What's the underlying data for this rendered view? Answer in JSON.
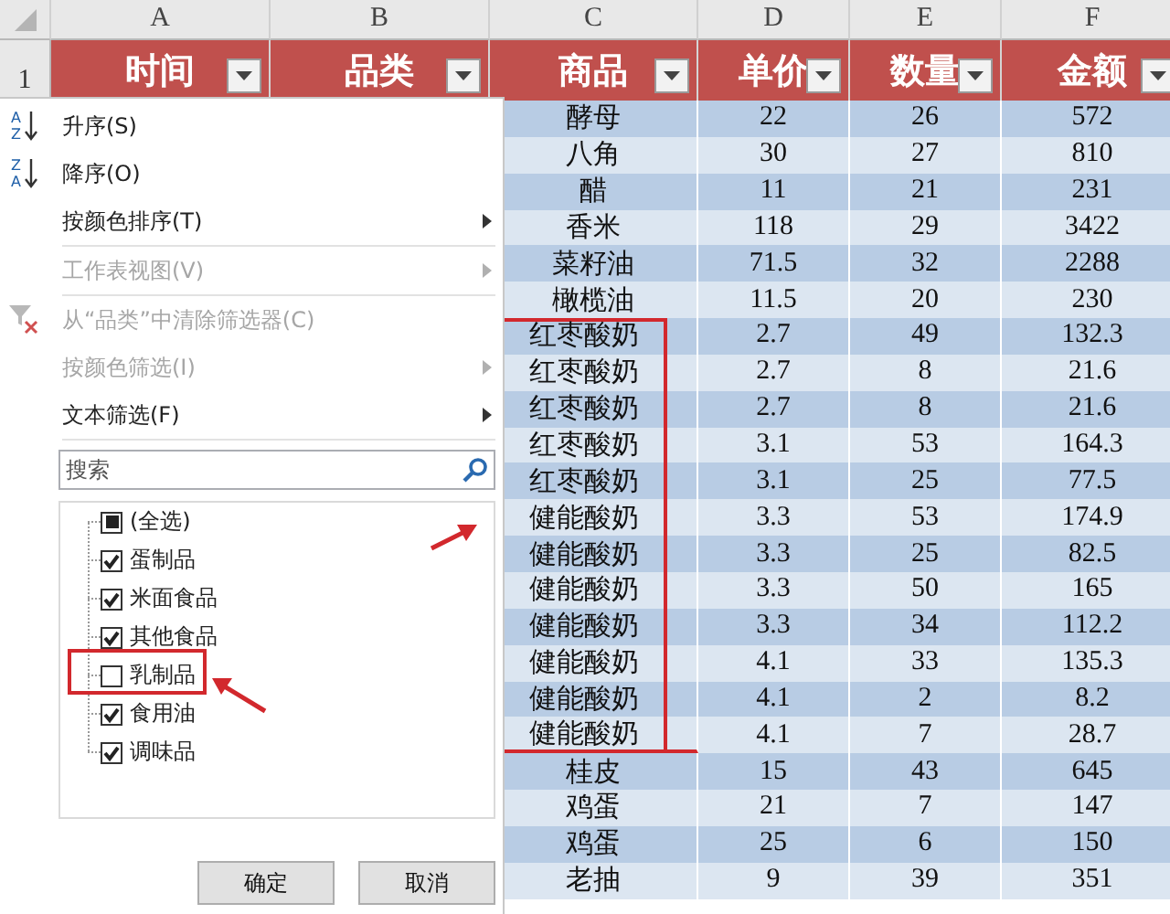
{
  "columns": [
    {
      "letter": "A",
      "header": "时间"
    },
    {
      "letter": "B",
      "header": "品类"
    },
    {
      "letter": "C",
      "header": "商品"
    },
    {
      "letter": "D",
      "header": "单价"
    },
    {
      "letter": "E",
      "header": "数量"
    },
    {
      "letter": "F",
      "header": "金额"
    }
  ],
  "row_header": "1",
  "rows": [
    {
      "product": "酵母",
      "price": "22",
      "qty": "26",
      "amount": "572",
      "marked": false
    },
    {
      "product": "八角",
      "price": "30",
      "qty": "27",
      "amount": "810",
      "marked": false
    },
    {
      "product": "醋",
      "price": "11",
      "qty": "21",
      "amount": "231",
      "marked": false
    },
    {
      "product": "香米",
      "price": "118",
      "qty": "29",
      "amount": "3422",
      "marked": false
    },
    {
      "product": "菜籽油",
      "price": "71.5",
      "qty": "32",
      "amount": "2288",
      "marked": false
    },
    {
      "product": "橄榄油",
      "price": "11.5",
      "qty": "20",
      "amount": "230",
      "marked": false
    },
    {
      "product": "红枣酸奶",
      "price": "2.7",
      "qty": "49",
      "amount": "132.3",
      "marked": true
    },
    {
      "product": "红枣酸奶",
      "price": "2.7",
      "qty": "8",
      "amount": "21.6",
      "marked": true
    },
    {
      "product": "红枣酸奶",
      "price": "2.7",
      "qty": "8",
      "amount": "21.6",
      "marked": true
    },
    {
      "product": "红枣酸奶",
      "price": "3.1",
      "qty": "53",
      "amount": "164.3",
      "marked": true
    },
    {
      "product": "红枣酸奶",
      "price": "3.1",
      "qty": "25",
      "amount": "77.5",
      "marked": true
    },
    {
      "product": "健能酸奶",
      "price": "3.3",
      "qty": "53",
      "amount": "174.9",
      "marked": true
    },
    {
      "product": "健能酸奶",
      "price": "3.3",
      "qty": "25",
      "amount": "82.5",
      "marked": true
    },
    {
      "product": "健能酸奶",
      "price": "3.3",
      "qty": "50",
      "amount": "165",
      "marked": true
    },
    {
      "product": "健能酸奶",
      "price": "3.3",
      "qty": "34",
      "amount": "112.2",
      "marked": true
    },
    {
      "product": "健能酸奶",
      "price": "4.1",
      "qty": "33",
      "amount": "135.3",
      "marked": true
    },
    {
      "product": "健能酸奶",
      "price": "4.1",
      "qty": "2",
      "amount": "8.2",
      "marked": true
    },
    {
      "product": "健能酸奶",
      "price": "4.1",
      "qty": "7",
      "amount": "28.7",
      "marked": true
    },
    {
      "product": "桂皮",
      "price": "15",
      "qty": "43",
      "amount": "645",
      "marked": false
    },
    {
      "product": "鸡蛋",
      "price": "21",
      "qty": "7",
      "amount": "147",
      "marked": false
    },
    {
      "product": "鸡蛋",
      "price": "25",
      "qty": "6",
      "amount": "150",
      "marked": false
    },
    {
      "product": "老抽",
      "price": "9",
      "qty": "39",
      "amount": "351",
      "marked": false
    }
  ],
  "filter_menu": {
    "items": [
      {
        "kind": "sort",
        "label": "升序(S)",
        "icon_top": "A",
        "icon_bottom": "Z",
        "disabled": false,
        "separator_after": false
      },
      {
        "kind": "sort",
        "label": "降序(O)",
        "icon_top": "Z",
        "icon_bottom": "A",
        "disabled": false,
        "separator_after": false
      },
      {
        "kind": "submenu",
        "label": "按颜色排序(T)",
        "disabled": false,
        "separator_after": true
      },
      {
        "kind": "submenu",
        "label": "工作表视图(V)",
        "disabled": true,
        "separator_after": true
      },
      {
        "kind": "clear",
        "label": "从“品类”中清除筛选器(C)",
        "disabled": true,
        "separator_after": false
      },
      {
        "kind": "submenu",
        "label": "按颜色筛选(I)",
        "disabled": true,
        "separator_after": false
      },
      {
        "kind": "submenu",
        "label": "文本筛选(F)",
        "disabled": false,
        "separator_after": true
      }
    ],
    "search": {
      "placeholder": "搜索"
    },
    "checklist": [
      {
        "label": "(全选)",
        "checked": false,
        "indeterminate": true,
        "marked": false
      },
      {
        "label": "蛋制品",
        "checked": true,
        "indeterminate": false,
        "marked": false
      },
      {
        "label": "米面食品",
        "checked": true,
        "indeterminate": false,
        "marked": false
      },
      {
        "label": "其他食品",
        "checked": true,
        "indeterminate": false,
        "marked": false
      },
      {
        "label": "乳制品",
        "checked": false,
        "indeterminate": false,
        "marked": true
      },
      {
        "label": "食用油",
        "checked": true,
        "indeterminate": false,
        "marked": false
      },
      {
        "label": "调味品",
        "checked": true,
        "indeterminate": false,
        "marked": false
      }
    ],
    "buttons": [
      "确定",
      "取消"
    ]
  }
}
